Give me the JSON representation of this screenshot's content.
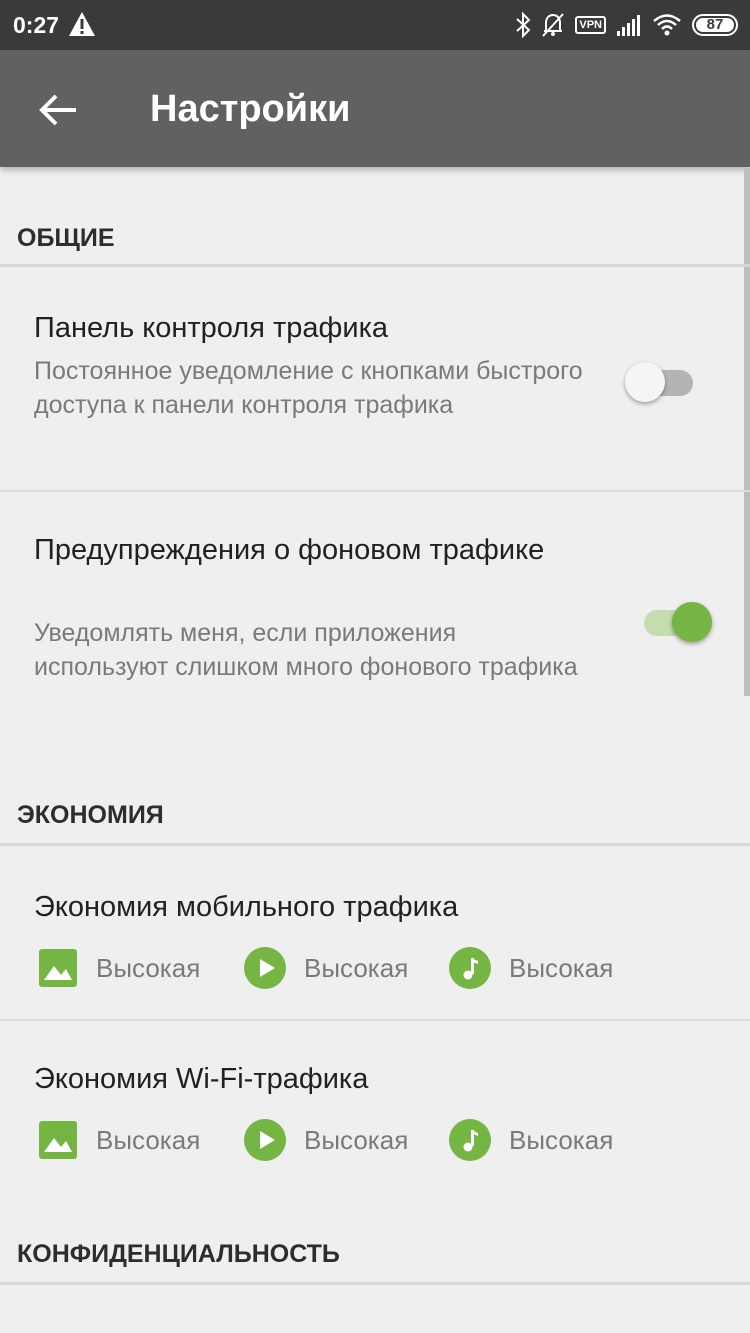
{
  "status_bar": {
    "time": "0:27",
    "vpn": "VPN",
    "battery": "87",
    "icons": [
      "warning-icon",
      "bluetooth-icon",
      "bell-muted-icon",
      "vpn-icon",
      "signal-icon",
      "wifi-icon",
      "battery-icon"
    ]
  },
  "toolbar": {
    "title": "Настройки",
    "back_icon": "arrow-back-icon"
  },
  "sections": {
    "general": {
      "header": "ОБЩИЕ",
      "traffic_panel": {
        "title": "Панель контроля трафика",
        "summary": "Постоянное уведомление с кнопками быстрого доступа к панели контроля трафика",
        "enabled": false
      },
      "background_warnings": {
        "title": "Предупреждения о фоновом трафике",
        "summary": "Уведомлять меня, если приложения используют слишком много фонового трафика",
        "enabled": true
      }
    },
    "economy": {
      "header": "ЭКОНОМИЯ",
      "mobile": {
        "title": "Экономия мобильного трафика",
        "images": "Высокая",
        "video": "Высокая",
        "audio": "Высокая"
      },
      "wifi": {
        "title": "Экономия Wi-Fi-трафика",
        "images": "Высокая",
        "video": "Высокая",
        "audio": "Высокая"
      }
    },
    "privacy": {
      "header": "КОНФИДЕНЦИАЛЬНОСТЬ"
    }
  },
  "colors": {
    "status_bar": "#3a3a3a",
    "toolbar": "#616161",
    "background": "#efefef",
    "accent_green": "#74b544",
    "switch_on_track": "#c4dcae",
    "switch_off_track": "#b4b4b4"
  }
}
